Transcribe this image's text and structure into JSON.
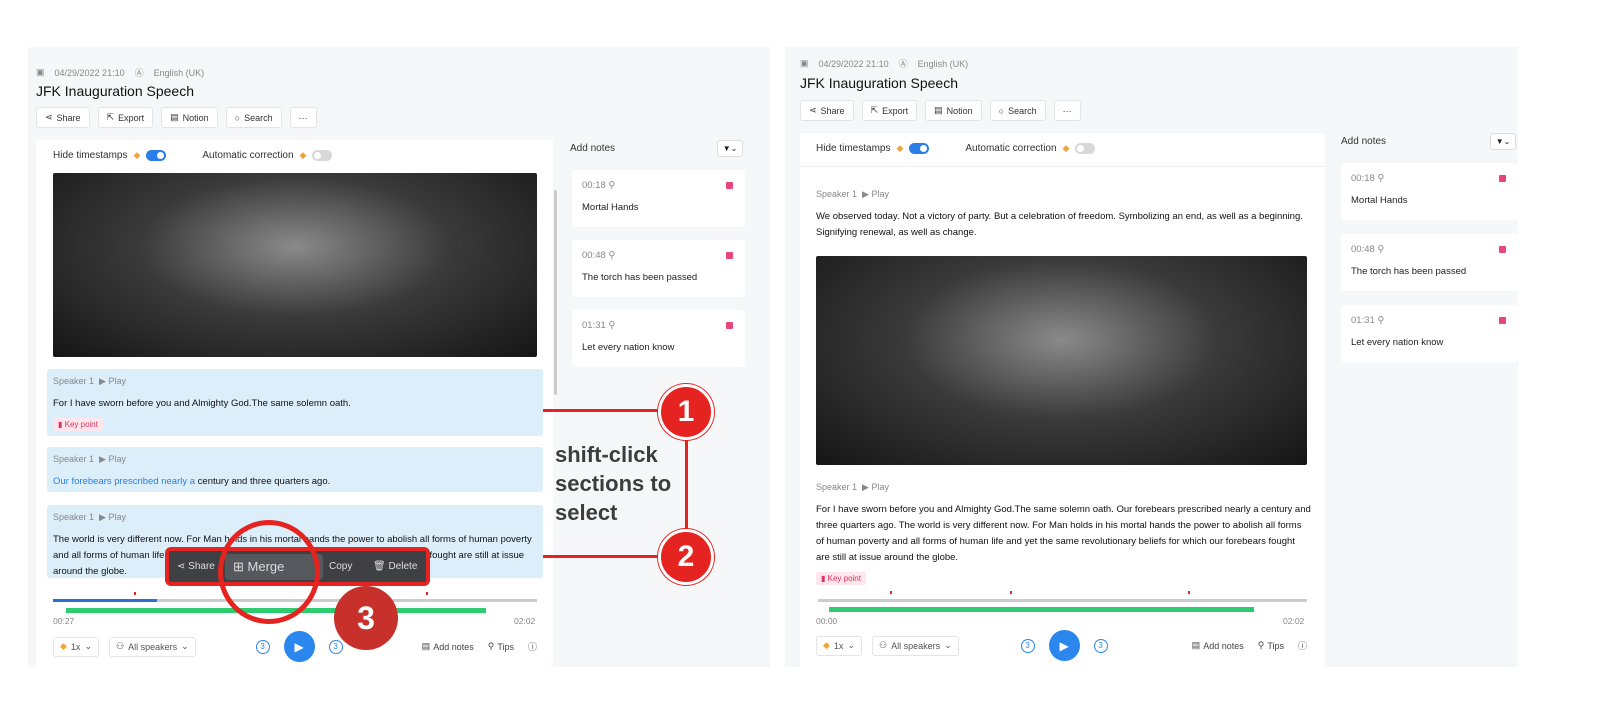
{
  "meta": {
    "date": "04/29/2022 21:10",
    "language": "English (UK)"
  },
  "title": "JFK Inauguration Speech",
  "toolbar": {
    "share": "Share",
    "export": "Export",
    "notion": "Notion",
    "search": "Search",
    "more": "···"
  },
  "toggles": {
    "hide_timestamps": "Hide timestamps",
    "hide_timestamps_on": true,
    "auto_correction": "Automatic correction",
    "auto_correction_on": false
  },
  "notes": {
    "header": "Add notes",
    "items": [
      {
        "time": "00:18",
        "label": "Mortal Hands"
      },
      {
        "time": "00:48",
        "label": "The torch has been passed"
      },
      {
        "time": "01:31",
        "label": "Let every nation know"
      }
    ]
  },
  "left": {
    "segments": [
      {
        "speaker": "Speaker 1",
        "play": "▶ Play",
        "text": "For I have sworn before you and Almighty God.The same solemn oath.",
        "badge": "Key point"
      },
      {
        "speaker": "Speaker 1",
        "play": "▶ Play",
        "text_highlight": "Our forebears prescribed nearly a",
        "text": " century and three quarters ago."
      },
      {
        "speaker": "Speaker 1",
        "play": "▶ Play",
        "text": "The world is very different now. For Man holds in his mortal hands the power to abolish all forms of human poverty and all forms of human life and yet the same revolutionary beliefs for which our forebears fought are still at issue around the globe."
      }
    ],
    "context_menu": {
      "share": "Share",
      "merge": "Merge",
      "copy": "Copy",
      "delete": "Delete"
    },
    "current_time": "00:27",
    "duration": "02:02",
    "progress": 0.2
  },
  "right": {
    "segments": [
      {
        "speaker": "Speaker 1",
        "play": "▶ Play",
        "text": "We observed today. Not a victory of party. But a celebration of freedom. Symbolizing an end, as well as a beginning. Signifying renewal, as well as change."
      },
      {
        "speaker": "Speaker 1",
        "play": "▶ Play",
        "text": "For I have sworn before you and Almighty God.The same solemn oath. Our forebears prescribed nearly a century and three quarters ago. The world is very different now. For Man holds in his mortal hands the power to abolish all forms of human poverty and all forms of human life and yet the same revolutionary beliefs for which our forebears fought are still at issue around the globe.",
        "badge": "Key point"
      }
    ],
    "current_time": "00:00",
    "duration": "02:02",
    "progress": 0
  },
  "player": {
    "speed": "1x",
    "speakers": "All speakers",
    "skip_back": "3",
    "skip_forward": "3",
    "add_notes": "Add notes",
    "tips": "Tips"
  },
  "annotations": {
    "step1": "1",
    "step2": "2",
    "step3": "3",
    "instruction": "shift-click sections to select"
  },
  "colors": {
    "accent": "#2b86ee",
    "annotation": "#e52421",
    "note_marker": "#e8457a",
    "segment_bg": "#dbeefa",
    "progress_green": "#2ecc71"
  }
}
